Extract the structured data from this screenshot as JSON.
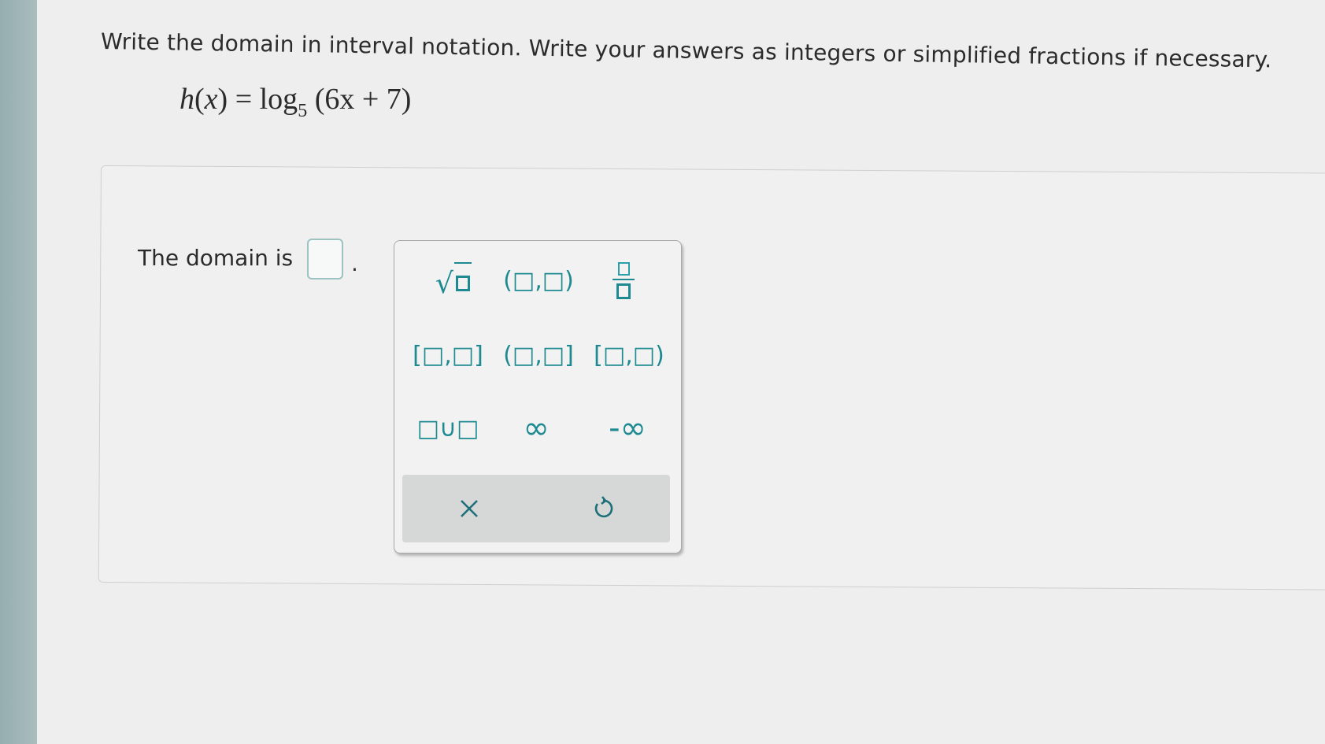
{
  "question": {
    "instructions": "Write the domain in interval notation. Write your answers as integers or simplified fractions if necessary.",
    "equation": {
      "function_name": "h",
      "variable": "x",
      "equals": "=",
      "log": "log",
      "base": "5",
      "argument": "(6x + 7)"
    }
  },
  "answer": {
    "label": "The domain is",
    "value": "",
    "trailing": "."
  },
  "palette": {
    "keys": [
      {
        "name": "square-root",
        "text": ""
      },
      {
        "name": "open-interval",
        "text": "(□,□)"
      },
      {
        "name": "fraction",
        "text": ""
      },
      {
        "name": "closed-interval",
        "text": "[□,□]"
      },
      {
        "name": "left-open-interval",
        "text": "(□,□]"
      },
      {
        "name": "right-open-interval",
        "text": "[□,□)"
      },
      {
        "name": "union",
        "text": "□∪□"
      },
      {
        "name": "infinity",
        "text": "∞"
      },
      {
        "name": "negative-infinity",
        "text": "-∞"
      }
    ],
    "clear_icon": "close-icon",
    "undo_icon": "undo-icon"
  },
  "colors": {
    "accent": "#1d8a92",
    "left_bar": "#9fb5b7",
    "control_bar": "#d6d8d8"
  }
}
